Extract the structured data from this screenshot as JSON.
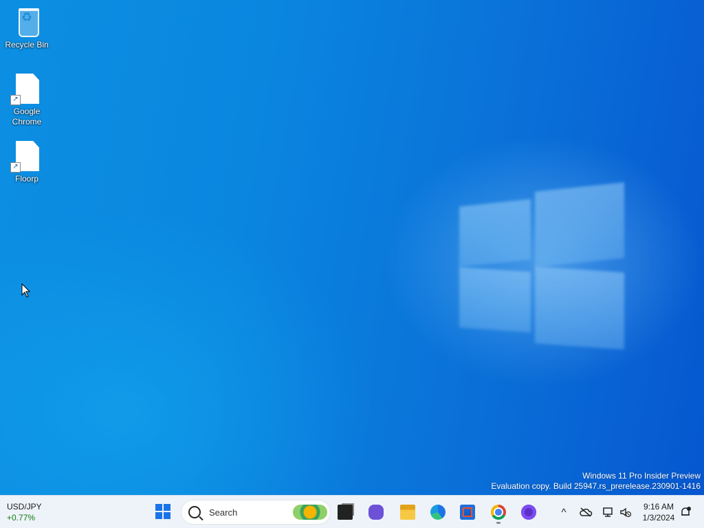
{
  "desktop": {
    "icons": [
      {
        "label": "Recycle Bin",
        "icon": "recycle-bin-icon"
      },
      {
        "label": "Google Chrome",
        "icon": "shortcut-file-icon"
      },
      {
        "label": "Floorp",
        "icon": "shortcut-file-icon"
      }
    ],
    "watermark": {
      "line1": "Windows 11 Pro Insider Preview",
      "line2": "Evaluation copy. Build 25947.rs_prerelease.230901-1416"
    }
  },
  "taskbar": {
    "widget": {
      "pair": "USD/JPY",
      "change": "+0.77%",
      "change_color": "#0f7b0f"
    },
    "search": {
      "placeholder": "Search"
    },
    "apps": [
      {
        "name": "start",
        "icon": "windows-start-icon"
      },
      {
        "name": "task-view",
        "icon": "task-view-icon"
      },
      {
        "name": "chat",
        "icon": "chat-icon"
      },
      {
        "name": "file-explorer",
        "icon": "folder-icon"
      },
      {
        "name": "edge",
        "icon": "edge-icon"
      },
      {
        "name": "store",
        "icon": "store-icon"
      },
      {
        "name": "chrome",
        "icon": "chrome-icon",
        "running": true
      },
      {
        "name": "floorp",
        "icon": "floorp-icon"
      }
    ],
    "tray": {
      "chevron": "^",
      "icons": [
        "onedrive-icon",
        "network-icon",
        "volume-muted-icon",
        "notification-icon"
      ]
    },
    "clock": {
      "time": "9:16 AM",
      "date": "1/3/2024"
    }
  },
  "colors": {
    "accent": "#1a73e8",
    "desktop_blue": "#0a86df",
    "taskbar_bg": "#eef3f9"
  }
}
